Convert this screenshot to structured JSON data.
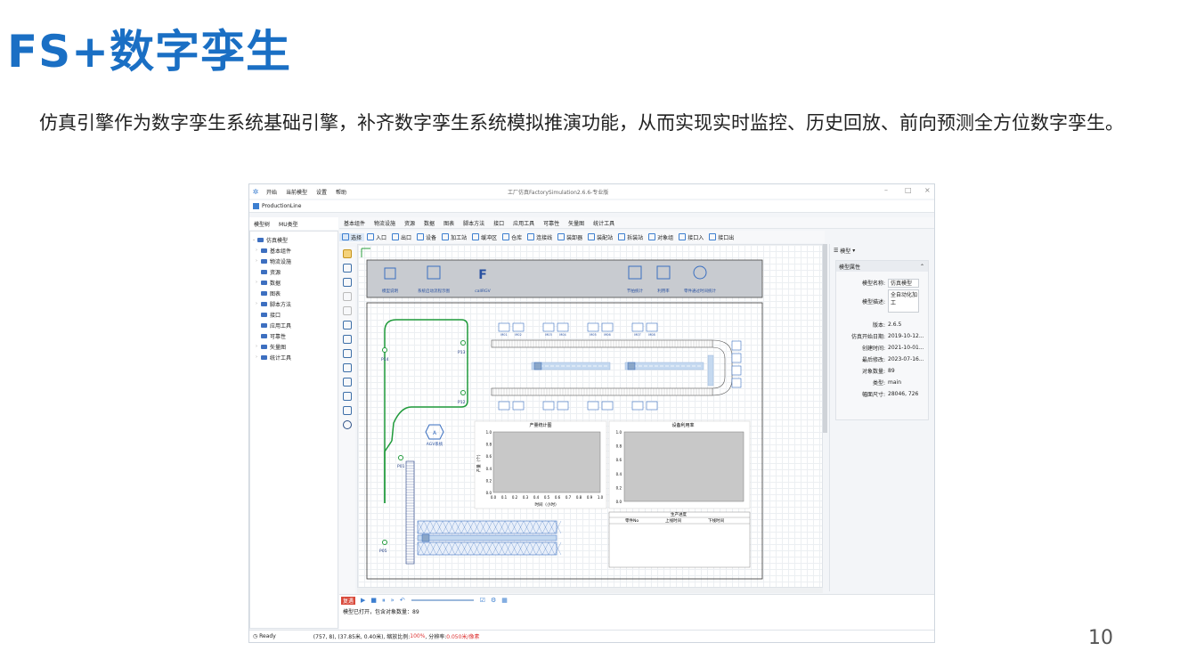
{
  "slide": {
    "title": "FS+数字孪生",
    "body": "仿真引擎作为数字孪生系统基础引擎，补齐数字孪生系统模拟推演功能，从而实现实时监控、历史回放、前向预测全方位数字孪生。",
    "page_number": "10"
  },
  "app": {
    "window_title": "工厂仿真FactorySimulation2.6.6-专业版",
    "menu": [
      "开始",
      "当前模型",
      "设置",
      "帮助"
    ],
    "project_name": "ProductionLine",
    "left_tabs": [
      "模型树",
      "MU类型"
    ],
    "tree": [
      "仿真模型",
      "基本组件",
      "物流设施",
      "资源",
      "数据",
      "图表",
      "脚本方法",
      "接口",
      "应用工具",
      "可靠性",
      "矢量图",
      "统计工具"
    ],
    "ribbon": [
      "基本组件",
      "物流设施",
      "资源",
      "数据",
      "图表",
      "脚本方法",
      "接口",
      "应用工具",
      "可靠性",
      "矢量图",
      "统计工具"
    ],
    "toolbar": [
      "选择",
      "入口",
      "出口",
      "设备",
      "加工站",
      "缓冲区",
      "仓库",
      "连接线",
      "装卸器",
      "装配站",
      "拆装站",
      "对象组",
      "接口入",
      "接口出"
    ],
    "canvas": {
      "top_buttons": [
        "模型说明",
        "系统启动流程示图",
        "callRGV",
        "节拍统计",
        "利用率",
        "零件通过时间统计"
      ],
      "agv_label": "AGV系统",
      "nodes": [
        "P14",
        "P13",
        "P12",
        "P01",
        "P05",
        "P04"
      ],
      "chart1_title": "产量统计图",
      "chart1_xlabel": "时间（小时）",
      "chart1_ylabel": "产量（个）",
      "chart1_yticks": [
        "1.0",
        "0.8",
        "0.6",
        "0.4",
        "0.2",
        "0.0"
      ],
      "chart1_xticks": [
        "0.0",
        "0.1",
        "0.2",
        "0.3",
        "0.4",
        "0.5",
        "0.6",
        "0.7",
        "0.8",
        "0.9",
        "1.0"
      ],
      "chart2_title": "设备利用率",
      "chart2_yticks": [
        "1.0",
        "0.8",
        "0.6",
        "0.4",
        "0.2",
        "0.0"
      ],
      "table_title": "生产进度",
      "table_cols": [
        "零件No",
        "上线时间",
        "下线时间"
      ],
      "machine_labels": [
        "M01",
        "M02",
        "M03",
        "M04",
        "M05",
        "M06",
        "M07",
        "M08"
      ]
    },
    "right_panel": {
      "view_label": "模型",
      "section_title": "模型属性",
      "model_name_label": "模型名称:",
      "model_name_value": "仿真模型",
      "model_desc_label": "模型描述:",
      "model_desc_value": "全自动化加工",
      "version_label": "版本:",
      "version_value": "2.6.5",
      "start_date_label": "仿真开始日期:",
      "start_date_value": "2019-10-12...",
      "created_label": "创建时间:",
      "created_value": "2021-10-01...",
      "modified_label": "最后修改:",
      "modified_value": "2023-07-16...",
      "count_label": "对象数量:",
      "count_value": "89",
      "type_label": "类型:",
      "type_value": "main",
      "size_label": "幅面尺寸:",
      "size_value": "28046, 726"
    },
    "bottom": {
      "reset_label": "复遇",
      "log": "模型已打开，包含对象数量：89"
    },
    "status": {
      "ready": "Ready",
      "coords": "(757, 8), (37.85米, 0.40米), 缩放比例: ",
      "zoom": "100%",
      "res_label": ", 分辨率: ",
      "resolution": "0.050米/像素"
    }
  }
}
